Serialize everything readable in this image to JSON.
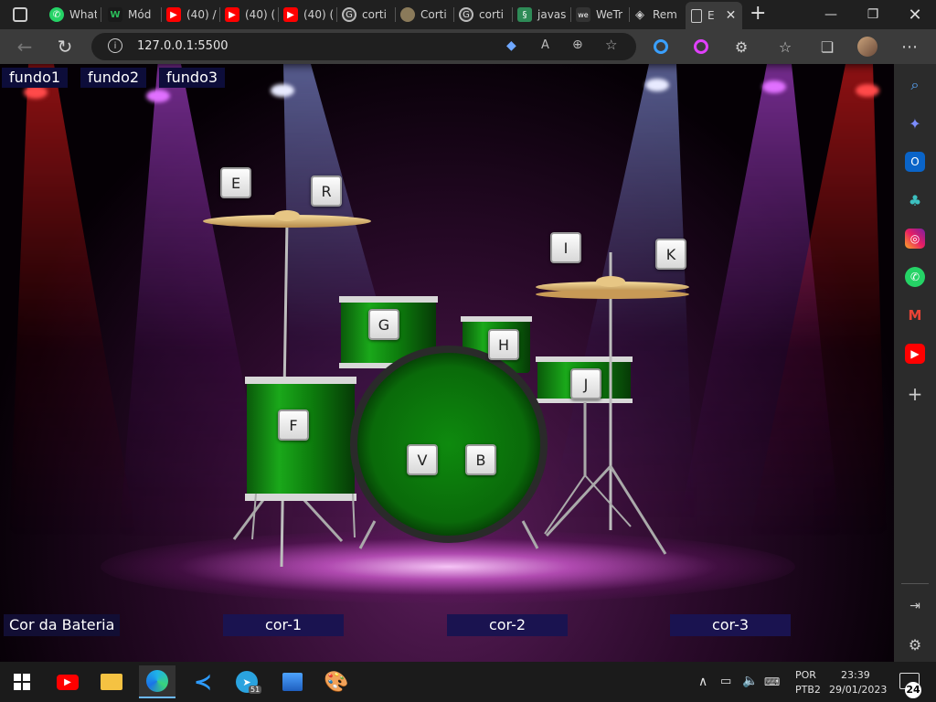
{
  "browser": {
    "tabs": [
      {
        "label": "What",
        "icon": "whatsapp-icon",
        "color": "#25D366"
      },
      {
        "label": "Mód",
        "icon": "w-logo-icon",
        "color": "#1a7f3c"
      },
      {
        "label": "(40) /",
        "icon": "youtube-icon",
        "color": "#FF0000"
      },
      {
        "label": "(40) (",
        "icon": "youtube-icon",
        "color": "#FF0000"
      },
      {
        "label": "(40) (",
        "icon": "youtube-icon",
        "color": "#FF0000"
      },
      {
        "label": "corti",
        "icon": "google-icon",
        "color": "#4285F4"
      },
      {
        "label": "Corti",
        "icon": "hat-icon",
        "color": "#8a7a5a"
      },
      {
        "label": "corti",
        "icon": "google-icon",
        "color": "#4285F4"
      },
      {
        "label": "javas",
        "icon": "book-icon",
        "color": "#2e8b57"
      },
      {
        "label": "WeTr",
        "icon": "wetransfer-icon",
        "color": "#333333"
      },
      {
        "label": "Rem",
        "icon": "layers-icon",
        "color": "#888888"
      },
      {
        "label": "E",
        "icon": "page-icon",
        "color": "#cccccc",
        "active": true
      }
    ],
    "address": "127.0.0.1:5500"
  },
  "page": {
    "backgrounds": [
      "fundo1",
      "fundo2",
      "fundo3"
    ],
    "keys": {
      "e": "E",
      "r": "R",
      "i": "I",
      "k": "K",
      "g": "G",
      "h": "H",
      "j": "J",
      "f": "F",
      "v": "V",
      "b": "B"
    },
    "color_label": "Cor da Bateria",
    "colors": [
      "cor-1",
      "cor-2",
      "cor-3"
    ],
    "drum_color": "#0f8a0f",
    "cymbal_color": "#d9b36a"
  },
  "taskbar": {
    "lang": "POR",
    "layout": "PTB2",
    "time": "23:39",
    "date": "29/01/2023",
    "notifications": "24",
    "telegram_badge": "51"
  }
}
